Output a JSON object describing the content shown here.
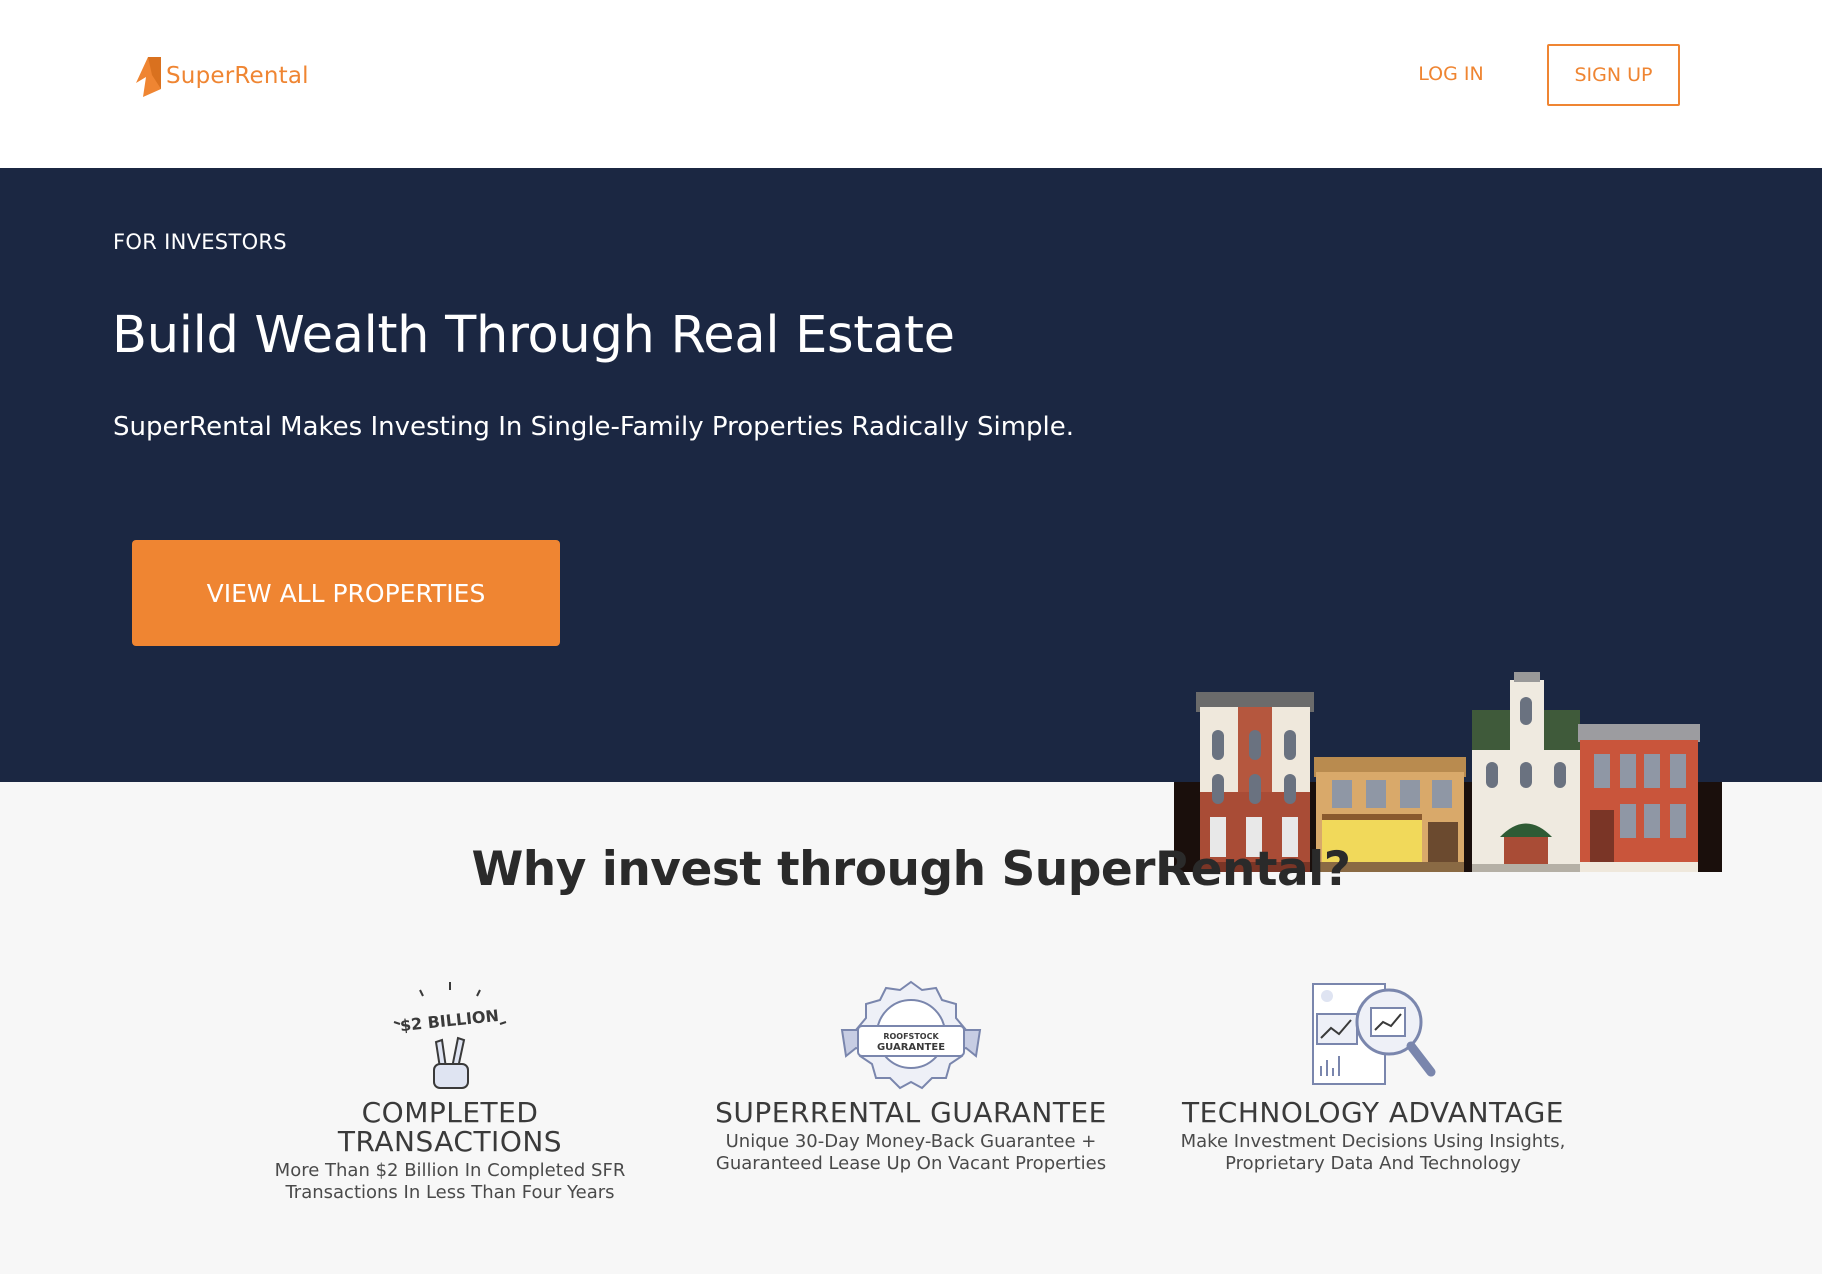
{
  "header": {
    "logo_text": "SuperRental",
    "login_label": "LOG IN",
    "signup_label": "SIGN UP"
  },
  "hero": {
    "eyebrow": "FOR INVESTORS",
    "title": "Build Wealth Through Real Estate",
    "subtitle": "SuperRental Makes Investing In Single-Family Properties Radically Simple.",
    "cta_label": "VIEW ALL PROPERTIES"
  },
  "why": {
    "title": "Why invest through SuperRental?",
    "features": [
      {
        "icon": "two-billion-hand-icon",
        "icon_text": "$2 BILLION",
        "title_line1": "COMPLETED",
        "title_line2": "TRANSACTIONS",
        "desc_line1": "More Than $2 Billion In Completed SFR",
        "desc_line2": "Transactions In Less Than Four Years"
      },
      {
        "icon": "guarantee-badge-icon",
        "icon_text_top": "ROOFSTOCK",
        "icon_text_bottom": "GUARANTEE",
        "title_line1": "SUPERRENTAL GUARANTEE",
        "desc_line1": "Unique 30-Day Money-Back Guarantee +",
        "desc_line2": "Guaranteed Lease Up On Vacant Properties"
      },
      {
        "icon": "analytics-magnifier-icon",
        "title_line1": "TECHNOLOGY ADVANTAGE",
        "desc_line1": "Make Investment Decisions Using Insights,",
        "desc_line2": "Proprietary Data And Technology"
      }
    ]
  },
  "colors": {
    "brand_orange": "#ef8532",
    "hero_navy": "#1b2742",
    "section_bg": "#f7f7f7"
  }
}
